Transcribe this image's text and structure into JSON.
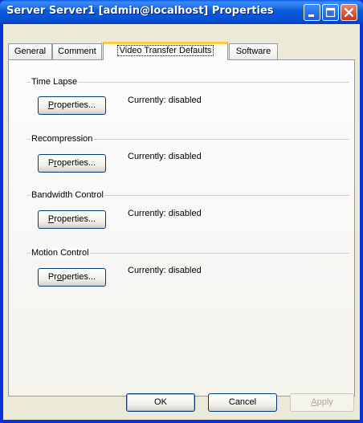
{
  "window": {
    "title": "Server Server1 [admin@localhost] Properties"
  },
  "tabs": [
    {
      "label": "General"
    },
    {
      "label": "Comment"
    },
    {
      "label": "Video Transfer Defaults"
    },
    {
      "label": "Software"
    }
  ],
  "active_tab_index": 2,
  "groups": [
    {
      "title": "Time Lapse",
      "button_label": "Properties...",
      "button_accel": "P",
      "button_rest": "roperties...",
      "status": "Currently: disabled"
    },
    {
      "title": "Recompression",
      "button_label": "Properties...",
      "button_accel": "r",
      "button_rest": "operties...",
      "status": "Currently: disabled"
    },
    {
      "title": "Bandwidth Control",
      "button_label": "Properties...",
      "button_accel": "P",
      "button_rest": "roperties...",
      "status": "Currently: disabled"
    },
    {
      "title": "Motion Control",
      "button_label": "Properties...",
      "button_accel": "o",
      "button_rest": "perties...",
      "status": "Currently: disabled"
    }
  ],
  "footer": {
    "ok_label": "OK",
    "cancel_label": "Cancel",
    "apply_label": "Apply"
  },
  "colors": {
    "titlebar": "#0b5bd9",
    "dialog_face": "#ece9d8",
    "active_tab_accent": "#ffc83c"
  },
  "icons": {
    "minimize": "minimize-icon",
    "maximize": "maximize-icon",
    "close": "close-icon"
  }
}
